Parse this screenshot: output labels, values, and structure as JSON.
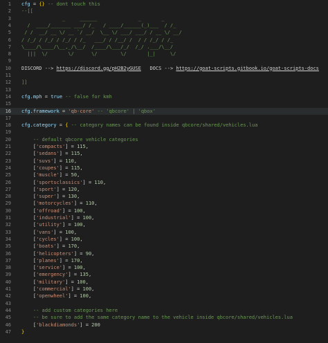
{
  "editor": {
    "lines": [
      {
        "n": "1",
        "segs": [
          {
            "c": "kw",
            "t": "cfg"
          },
          {
            "c": "op",
            "t": " = "
          },
          {
            "c": "br",
            "t": "{}"
          },
          {
            "c": "cm",
            "t": " -- dont touch this"
          }
        ]
      },
      {
        "n": "2",
        "segs": [
          {
            "c": "cm",
            "t": "--[["
          }
        ]
      },
      {
        "n": "3",
        "segs": [
          {
            "c": "art",
            "t": "              _     ______              _       _"
          }
        ]
      },
      {
        "n": "4",
        "segs": [
          {
            "c": "art",
            "t": "  /  ____/_______ ___/ /_   / ____/______(_)___  / /_"
          }
        ]
      },
      {
        "n": "5",
        "segs": [
          {
            "c": "art",
            "t": " / /  __/ __ \\/ __ `/ __/  \\__ \\/ ___/ ___/ / __ \\/ __/"
          }
        ]
      },
      {
        "n": "6",
        "segs": [
          {
            "c": "art",
            "t": "/ /_/ / /_/ / /_/ / /_   ___/ / /__/ /  / / /_/ / /_"
          }
        ]
      },
      {
        "n": "7",
        "segs": [
          {
            "c": "art",
            "t": "\\____/\\____/\\__,_/\\__/  /____/\\___/_/  /_/ .___/\\__/"
          }
        ]
      },
      {
        "n": "8",
        "segs": [
          {
            "c": "art",
            "t": "  |||  \\/       \\/      \\/        \\/       |_|     \\/"
          }
        ]
      },
      {
        "n": "9",
        "segs": [
          {
            "c": "op",
            "t": ""
          }
        ]
      },
      {
        "n": "10",
        "segs": [
          {
            "c": "op",
            "t": "DISCORD --> "
          },
          {
            "c": "link",
            "t": "https://discord.gg/pH2B2yGUSE"
          },
          {
            "c": "op",
            "t": "   DOCS --> "
          },
          {
            "c": "link",
            "t": "https://goat-scripts.gitbook.io/goat-scripts-docs"
          }
        ]
      },
      {
        "n": "11",
        "segs": [
          {
            "c": "op",
            "t": ""
          }
        ]
      },
      {
        "n": "12",
        "segs": [
          {
            "c": "cm",
            "t": "]]"
          }
        ]
      },
      {
        "n": "13",
        "segs": [
          {
            "c": "op",
            "t": ""
          }
        ]
      },
      {
        "n": "14",
        "segs": [
          {
            "c": "kw",
            "t": "cfg"
          },
          {
            "c": "op",
            "t": "."
          },
          {
            "c": "kw",
            "t": "mph"
          },
          {
            "c": "op",
            "t": " = "
          },
          {
            "c": "kw",
            "t": "true"
          },
          {
            "c": "cm",
            "t": " -- false for kmh"
          }
        ]
      },
      {
        "n": "15",
        "segs": [
          {
            "c": "op",
            "t": ""
          }
        ]
      },
      {
        "n": "16",
        "current": true,
        "segs": [
          {
            "c": "kw",
            "t": "cfg"
          },
          {
            "c": "op",
            "t": "."
          },
          {
            "c": "kw",
            "t": "framework"
          },
          {
            "c": "op",
            "t": " = "
          },
          {
            "c": "st",
            "t": "'qb-core'"
          },
          {
            "c": "cm",
            "t": " -- 'qbcore' | 'qbox'"
          }
        ]
      },
      {
        "n": "17",
        "segs": [
          {
            "c": "op",
            "t": ""
          }
        ]
      },
      {
        "n": "18",
        "segs": [
          {
            "c": "kw",
            "t": "cfg"
          },
          {
            "c": "op",
            "t": "."
          },
          {
            "c": "kw",
            "t": "category"
          },
          {
            "c": "op",
            "t": " = "
          },
          {
            "c": "br",
            "t": "{"
          },
          {
            "c": "cm",
            "t": " -- category names can be found inside qbcore/shared/vehicles.lua"
          }
        ]
      },
      {
        "n": "19",
        "segs": [
          {
            "c": "op",
            "t": ""
          }
        ]
      },
      {
        "n": "20",
        "segs": [
          {
            "c": "cm",
            "t": "    -- default qbcore vehicle categories"
          }
        ]
      },
      {
        "n": "21",
        "segs": [
          {
            "c": "op",
            "t": "    ["
          },
          {
            "c": "st",
            "t": "'compacts'"
          },
          {
            "c": "op",
            "t": "] = "
          },
          {
            "c": "nm",
            "t": "115"
          },
          {
            "c": "op",
            "t": ","
          }
        ]
      },
      {
        "n": "22",
        "segs": [
          {
            "c": "op",
            "t": "    ["
          },
          {
            "c": "st",
            "t": "'sedans'"
          },
          {
            "c": "op",
            "t": "] = "
          },
          {
            "c": "nm",
            "t": "115"
          },
          {
            "c": "op",
            "t": ","
          }
        ]
      },
      {
        "n": "23",
        "segs": [
          {
            "c": "op",
            "t": "    ["
          },
          {
            "c": "st",
            "t": "'suvs'"
          },
          {
            "c": "op",
            "t": "] = "
          },
          {
            "c": "nm",
            "t": "110"
          },
          {
            "c": "op",
            "t": ","
          }
        ]
      },
      {
        "n": "24",
        "segs": [
          {
            "c": "op",
            "t": "    ["
          },
          {
            "c": "st",
            "t": "'coupes'"
          },
          {
            "c": "op",
            "t": "] = "
          },
          {
            "c": "nm",
            "t": "115"
          },
          {
            "c": "op",
            "t": ","
          }
        ]
      },
      {
        "n": "25",
        "segs": [
          {
            "c": "op",
            "t": "    ["
          },
          {
            "c": "st",
            "t": "'muscle'"
          },
          {
            "c": "op",
            "t": "] = "
          },
          {
            "c": "nm",
            "t": "50"
          },
          {
            "c": "op",
            "t": ","
          }
        ]
      },
      {
        "n": "26",
        "segs": [
          {
            "c": "op",
            "t": "    ["
          },
          {
            "c": "st",
            "t": "'sportsclassics'"
          },
          {
            "c": "op",
            "t": "] = "
          },
          {
            "c": "nm",
            "t": "110"
          },
          {
            "c": "op",
            "t": ","
          }
        ]
      },
      {
        "n": "27",
        "segs": [
          {
            "c": "op",
            "t": "    ["
          },
          {
            "c": "st",
            "t": "'sport'"
          },
          {
            "c": "op",
            "t": "] = "
          },
          {
            "c": "nm",
            "t": "120"
          },
          {
            "c": "op",
            "t": ","
          }
        ]
      },
      {
        "n": "28",
        "segs": [
          {
            "c": "op",
            "t": "    ["
          },
          {
            "c": "st",
            "t": "'super'"
          },
          {
            "c": "op",
            "t": "] = "
          },
          {
            "c": "nm",
            "t": "130"
          },
          {
            "c": "op",
            "t": ","
          }
        ]
      },
      {
        "n": "29",
        "segs": [
          {
            "c": "op",
            "t": "    ["
          },
          {
            "c": "st",
            "t": "'motorcycles'"
          },
          {
            "c": "op",
            "t": "] = "
          },
          {
            "c": "nm",
            "t": "110"
          },
          {
            "c": "op",
            "t": ","
          }
        ]
      },
      {
        "n": "30",
        "segs": [
          {
            "c": "op",
            "t": "    ["
          },
          {
            "c": "st",
            "t": "'offroad'"
          },
          {
            "c": "op",
            "t": "] = "
          },
          {
            "c": "nm",
            "t": "100"
          },
          {
            "c": "op",
            "t": ","
          }
        ]
      },
      {
        "n": "31",
        "segs": [
          {
            "c": "op",
            "t": "    ["
          },
          {
            "c": "st",
            "t": "'industrial'"
          },
          {
            "c": "op",
            "t": "] = "
          },
          {
            "c": "nm",
            "t": "100"
          },
          {
            "c": "op",
            "t": ","
          }
        ]
      },
      {
        "n": "32",
        "segs": [
          {
            "c": "op",
            "t": "    ["
          },
          {
            "c": "st",
            "t": "'utility'"
          },
          {
            "c": "op",
            "t": "] = "
          },
          {
            "c": "nm",
            "t": "100"
          },
          {
            "c": "op",
            "t": ","
          }
        ]
      },
      {
        "n": "33",
        "segs": [
          {
            "c": "op",
            "t": "    ["
          },
          {
            "c": "st",
            "t": "'vans'"
          },
          {
            "c": "op",
            "t": "] = "
          },
          {
            "c": "nm",
            "t": "100"
          },
          {
            "c": "op",
            "t": ","
          }
        ]
      },
      {
        "n": "34",
        "segs": [
          {
            "c": "op",
            "t": "    ["
          },
          {
            "c": "st",
            "t": "'cycles'"
          },
          {
            "c": "op",
            "t": "] = "
          },
          {
            "c": "nm",
            "t": "100"
          },
          {
            "c": "op",
            "t": ","
          }
        ]
      },
      {
        "n": "35",
        "segs": [
          {
            "c": "op",
            "t": "    ["
          },
          {
            "c": "st",
            "t": "'boats'"
          },
          {
            "c": "op",
            "t": "] = "
          },
          {
            "c": "nm",
            "t": "170"
          },
          {
            "c": "op",
            "t": ","
          }
        ]
      },
      {
        "n": "36",
        "segs": [
          {
            "c": "op",
            "t": "    ["
          },
          {
            "c": "st",
            "t": "'helicopters'"
          },
          {
            "c": "op",
            "t": "] = "
          },
          {
            "c": "nm",
            "t": "90"
          },
          {
            "c": "op",
            "t": ","
          }
        ]
      },
      {
        "n": "37",
        "segs": [
          {
            "c": "op",
            "t": "    ["
          },
          {
            "c": "st",
            "t": "'planes'"
          },
          {
            "c": "op",
            "t": "] = "
          },
          {
            "c": "nm",
            "t": "170"
          },
          {
            "c": "op",
            "t": ","
          }
        ]
      },
      {
        "n": "38",
        "segs": [
          {
            "c": "op",
            "t": "    ["
          },
          {
            "c": "st",
            "t": "'service'"
          },
          {
            "c": "op",
            "t": "] = "
          },
          {
            "c": "nm",
            "t": "100"
          },
          {
            "c": "op",
            "t": ","
          }
        ]
      },
      {
        "n": "39",
        "segs": [
          {
            "c": "op",
            "t": "    ["
          },
          {
            "c": "st",
            "t": "'emergency'"
          },
          {
            "c": "op",
            "t": "] = "
          },
          {
            "c": "nm",
            "t": "135"
          },
          {
            "c": "op",
            "t": ","
          }
        ]
      },
      {
        "n": "40",
        "segs": [
          {
            "c": "op",
            "t": "    ["
          },
          {
            "c": "st",
            "t": "'military'"
          },
          {
            "c": "op",
            "t": "] = "
          },
          {
            "c": "nm",
            "t": "100"
          },
          {
            "c": "op",
            "t": ","
          }
        ]
      },
      {
        "n": "41",
        "segs": [
          {
            "c": "op",
            "t": "    ["
          },
          {
            "c": "st",
            "t": "'commercial'"
          },
          {
            "c": "op",
            "t": "] = "
          },
          {
            "c": "nm",
            "t": "100"
          },
          {
            "c": "op",
            "t": ","
          }
        ]
      },
      {
        "n": "42",
        "segs": [
          {
            "c": "op",
            "t": "    ["
          },
          {
            "c": "st",
            "t": "'openwheel'"
          },
          {
            "c": "op",
            "t": "] = "
          },
          {
            "c": "nm",
            "t": "100"
          },
          {
            "c": "op",
            "t": ","
          }
        ]
      },
      {
        "n": "43",
        "segs": [
          {
            "c": "op",
            "t": ""
          }
        ]
      },
      {
        "n": "44",
        "segs": [
          {
            "c": "cm",
            "t": "    -- add custom categories here"
          }
        ]
      },
      {
        "n": "45",
        "segs": [
          {
            "c": "cm",
            "t": "    -- be sure to add the same category name to the vehicle inside qbcore/shared/vehicles.lua"
          }
        ]
      },
      {
        "n": "46",
        "segs": [
          {
            "c": "op",
            "t": "    ["
          },
          {
            "c": "st",
            "t": "'blackdiamonds'"
          },
          {
            "c": "op",
            "t": "] = "
          },
          {
            "c": "nm",
            "t": "200"
          }
        ]
      },
      {
        "n": "47",
        "segs": [
          {
            "c": "br",
            "t": "}"
          }
        ]
      }
    ]
  }
}
